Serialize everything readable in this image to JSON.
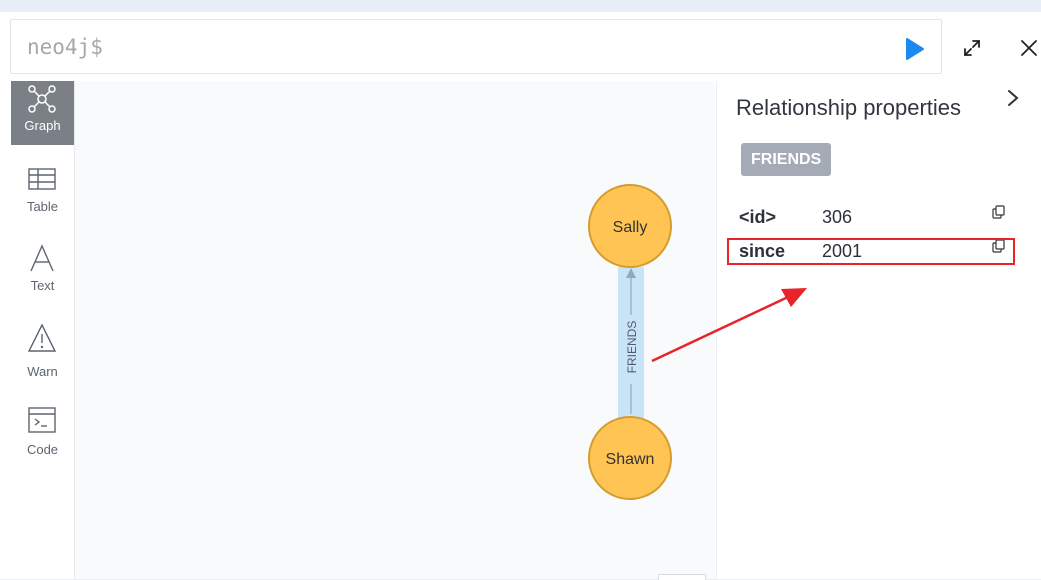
{
  "editor": {
    "prompt": "neo4j$"
  },
  "sidebar": {
    "items": [
      {
        "label": "Graph",
        "icon": "graph-icon",
        "active": true
      },
      {
        "label": "Table",
        "icon": "table-icon"
      },
      {
        "label": "Text",
        "icon": "text-icon"
      },
      {
        "label": "Warn",
        "icon": "warn-icon"
      },
      {
        "label": "Code",
        "icon": "code-icon"
      }
    ]
  },
  "graph": {
    "nodes": [
      {
        "label": "Sally"
      },
      {
        "label": "Shawn"
      }
    ],
    "relationship": {
      "type": "FRIENDS"
    },
    "colors": {
      "node_fill": "#ffc454",
      "node_stroke": "#d39e2e",
      "rel_highlight": "#c9e4f7",
      "rel_line": "#8fa8bd"
    }
  },
  "properties": {
    "title": "Relationship properties",
    "badge": "FRIENDS",
    "rows": [
      {
        "key": "<id>",
        "value": "306"
      },
      {
        "key": "since",
        "value": "2001"
      }
    ]
  },
  "annotation": {
    "color": "#e8232a"
  }
}
